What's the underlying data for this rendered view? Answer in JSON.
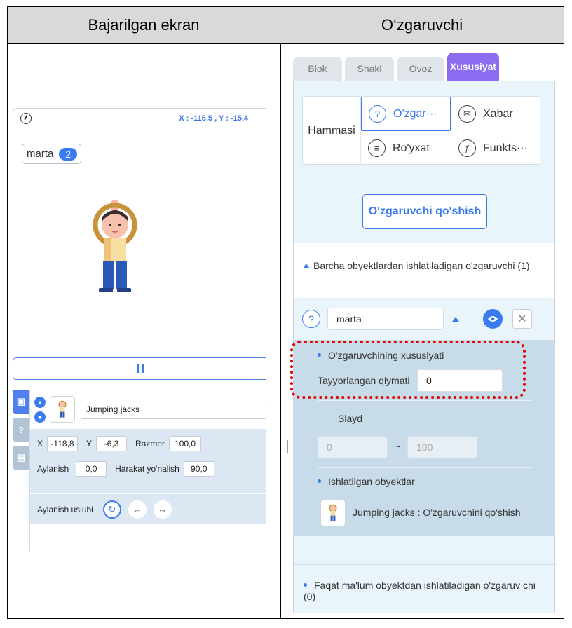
{
  "headers": {
    "left": "Bajarilgan ekran",
    "right": "O‘zgaruvchi"
  },
  "stage": {
    "coords": "X : -116,5 , Y : -15,4",
    "variable_name": "marta",
    "variable_value": "2"
  },
  "object_panel": {
    "object_name": "Jumping jacks",
    "x_label": "X",
    "x_value": "-118,8",
    "y_label": "Y",
    "y_value": "-6,3",
    "size_label": "Razmer",
    "size_value": "100,0",
    "rotation_label": "Aylanish",
    "rotation_value": "0,0",
    "direction_label": "Harakat yo'nalish",
    "direction_value": "90,0",
    "rotation_style_label": "Aylanish uslubi"
  },
  "tabs": [
    "Blok",
    "Shakl",
    "Ovoz",
    "Xususiyat"
  ],
  "categories": {
    "all": "Hammasi",
    "variable": "O'zgar···",
    "message": "Xabar",
    "list": "Ro'yxat",
    "function": "Funkts···"
  },
  "add_variable_button": "O'zgaruvchi qo'shish",
  "global_section": "Barcha obyektlardan ishlatiladigan o'zgaruvchi (1)",
  "variable_item": {
    "name": "marta"
  },
  "variable_detail": {
    "props_title": "O'zgaruvchining xususiyati",
    "default_label": "Tayyorlangan qiymati",
    "default_value": "0",
    "slide_label": "Slayd",
    "slide_min": "0",
    "slide_sep": "~",
    "slide_max": "100",
    "used_title": "Ishlatilgan obyektlar",
    "used_item": "Jumping jacks : O'zgaruvchini qo'shish"
  },
  "local_section": "Faqat ma'lum obyektdan ishlatiladigan o'zgaruv chi (0)",
  "colors": {
    "accent": "#3a7cf0",
    "active_tab": "#8c6cf0",
    "highlight": "#e00000"
  }
}
